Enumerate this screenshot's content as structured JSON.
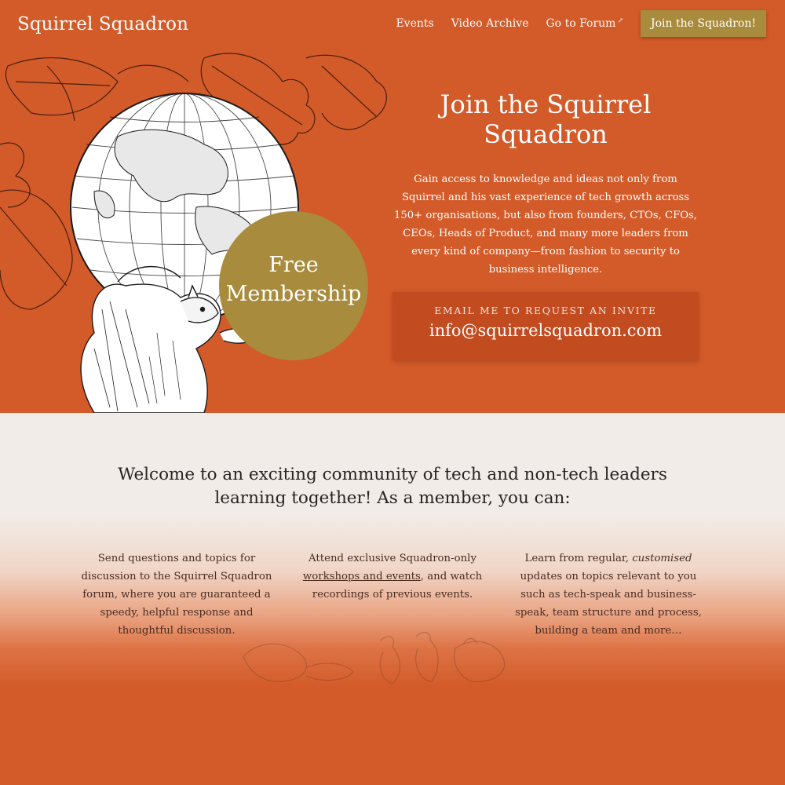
{
  "nav": {
    "brand": "Squirrel Squadron",
    "links": [
      "Events",
      "Video Archive",
      "Go to Forum"
    ],
    "join_label": "Join the Squadron!"
  },
  "hero": {
    "title": "Join the Squirrel Squadron",
    "text": "Gain access to knowledge and ideas not only from Squirrel and his vast experience of tech growth across 150+ organisations, but also from founders, CTOs, CFOs, CEOs, Heads of Product, and many more leaders from every kind of company—from fashion to security to business intelligence.",
    "badge_line1": "Free",
    "badge_line2": "Membership",
    "invite_label": "EMAIL ME TO REQUEST AN INVITE",
    "invite_email": "info@squirrelsquadron.com"
  },
  "welcome": {
    "line1": "Welcome to an exciting community of tech and non-tech leaders",
    "line2": "learning together! As a member, you can:"
  },
  "features": {
    "f1": "Send questions and topics for discussion to the Squirrel Squadron forum, where you are guaranteed a speedy, helpful response and thoughtful discussion.",
    "f2_pre": "Attend exclusive Squadron-only",
    "f2_link": "workshops and events",
    "f2_post": ", and watch recordings of previous events.",
    "f3_pre": "Learn from regular,",
    "f3_em": "customised",
    "f3_post": "updates on topics relevant to you such as tech-speak and business-speak, team structure and process, building a team and more…"
  },
  "colors": {
    "brand_orange": "#d35a29",
    "gold": "#a88b3c",
    "invite_box": "#c24b20",
    "cream": "#f2ece8"
  },
  "icons": {
    "external_link": "external-link-icon"
  }
}
